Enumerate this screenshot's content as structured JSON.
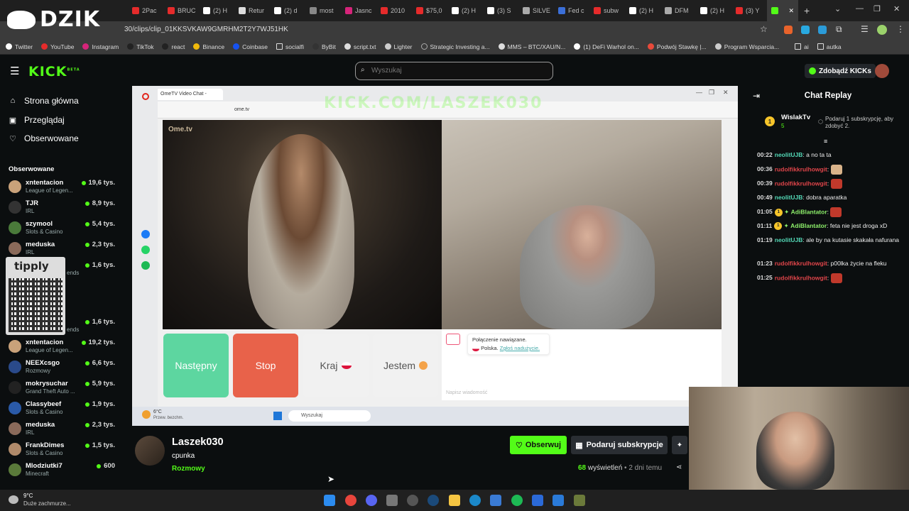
{
  "overlay": {
    "brand": "DZIK"
  },
  "browser": {
    "tabs": [
      "2Pac",
      "BRUC",
      "(2) H",
      "Retur",
      "(2) d",
      "most",
      "Jasnc",
      "2010",
      "$75,0",
      "(2) H",
      "(3) S",
      "SILVE",
      "Fed c",
      "subw",
      "(2) H",
      "DFM",
      "(2) H",
      "(3) Y",
      ""
    ],
    "url": "30/clips/clip_01KKSVKAW9GMRHM2T2Y7WJ51HK",
    "bookmarks": [
      "Twitter",
      "YouTube",
      "Instagram",
      "TikTok",
      "react",
      "Binance",
      "Coinbase",
      "socialfi",
      "ByBit",
      "script.txt",
      "Lighter",
      "Strategic Investing a...",
      "MMS – BTC/XAU/N...",
      "(1) DeFi Warhol on...",
      "Podwój Stawkę |...",
      "Program Wsparcia...",
      "ai",
      "autka"
    ]
  },
  "kick": {
    "logo": "KICK",
    "logo_badge": "BETA",
    "search_placeholder": "Wyszukaj",
    "get_kicks": "Zdobądź KICKs"
  },
  "sidebar": {
    "nav": [
      {
        "label": "Strona główna",
        "icon": "home-icon"
      },
      {
        "label": "Przeglądaj",
        "icon": "browse-icon"
      },
      {
        "label": "Obserwowane",
        "icon": "heart-icon"
      }
    ],
    "following_header": "Obserwowane",
    "streamers": [
      {
        "name": "xntentacion",
        "category": "League of Legen...",
        "viewers": "19,6 tys."
      },
      {
        "name": "TJR",
        "category": "IRL",
        "viewers": "8,9 tys."
      },
      {
        "name": "szymool",
        "category": "Slots & Casino",
        "viewers": "5,4 tys."
      },
      {
        "name": "meduska",
        "category": "IRL",
        "viewers": "2,3 tys."
      },
      {
        "name": "",
        "category": "ends",
        "viewers": "1,6 tys."
      },
      {
        "name": "",
        "category": "ends",
        "viewers": "1,6 tys."
      },
      {
        "name": "xntentacion",
        "category": "League of Legen...",
        "viewers": "19,2 tys."
      },
      {
        "name": "NEEXcsgo",
        "category": "Rozmowy",
        "viewers": "6,6 tys."
      },
      {
        "name": "mokrysuchar",
        "category": "Grand Theft Auto ...",
        "viewers": "5,9 tys."
      },
      {
        "name": "Classybeef",
        "category": "Slots & Casino",
        "viewers": "1,9 tys."
      },
      {
        "name": "meduska",
        "category": "IRL",
        "viewers": "2,3 tys."
      },
      {
        "name": "FrankDimes",
        "category": "Slots & Casino",
        "viewers": "1,5 tys."
      },
      {
        "name": "Mlodziutki7",
        "category": "Minecraft",
        "viewers": "600"
      }
    ],
    "qr_label": "tipply"
  },
  "stream": {
    "inner_tab": "OmeTV Video Chat -",
    "inner_url": "ome.tv",
    "watermark": "KICK.COM/LASZEK030",
    "ome_logo": "Ome.tv",
    "buttons": {
      "next": "Następny",
      "stop": "Stop",
      "country": "Kraj",
      "iam": "Jestem"
    },
    "connection": "Połączenie nawiązane.",
    "country_line": "Polska.",
    "report": "Zgłoś nadużycie.",
    "message_placeholder": "Napisz wiadomość",
    "weather_temp": "6°C",
    "weather_desc": "Przew. bezchm.",
    "taskbar_search": "Wyszukaj"
  },
  "chat": {
    "title": "Chat Replay",
    "pinned_user": "WislakTv",
    "pinned_count": "5",
    "pinned_rank": "1",
    "pinned_text": "Podaruj 1 subskrypcję, aby zdobyć 2.",
    "messages": [
      {
        "time": "00:22",
        "user": "neolitUJB",
        "color": "#53d8b6",
        "text": ": a no ta ta"
      },
      {
        "time": "00:36",
        "user": "rudolfikkrulhowgit",
        "color": "#e0454a",
        "text": ":"
      },
      {
        "time": "00:39",
        "user": "rudolfikkrulhowgit",
        "color": "#e0454a",
        "text": ":"
      },
      {
        "time": "00:49",
        "user": "neolitUJB",
        "color": "#53d8b6",
        "text": ": dobra aparatka"
      },
      {
        "time": "01:05",
        "user": "AdiBlantator",
        "color": "#8ef06b",
        "text": ":"
      },
      {
        "time": "01:11",
        "user": "AdiBlantator",
        "color": "#8ef06b",
        "text": ": feta nie jest droga xD"
      },
      {
        "time": "01:19",
        "user": "neolitUJB",
        "color": "#53d8b6",
        "text": ": ale by na kutasie skakała nafurana"
      },
      {
        "time": "01:23",
        "user": "rudolfikkrulhowgit",
        "color": "#e0454a",
        "text": ": p00lka życie na fleku"
      },
      {
        "time": "01:25",
        "user": "rudolfikkrulhowgit",
        "color": "#e0454a",
        "text": ":"
      }
    ]
  },
  "channel": {
    "name": "Laszek030",
    "subtitle": "cpunka",
    "category": "Rozmowy",
    "follow": "Obserwuj",
    "subscribe": "Podaruj subskrypcje",
    "views_count": "68",
    "views_label": "wyświetleń",
    "age": "• 2 dni temu"
  },
  "taskbar": {
    "weather_temp": "9°C",
    "weather_desc": "Duże zachmurze..."
  }
}
